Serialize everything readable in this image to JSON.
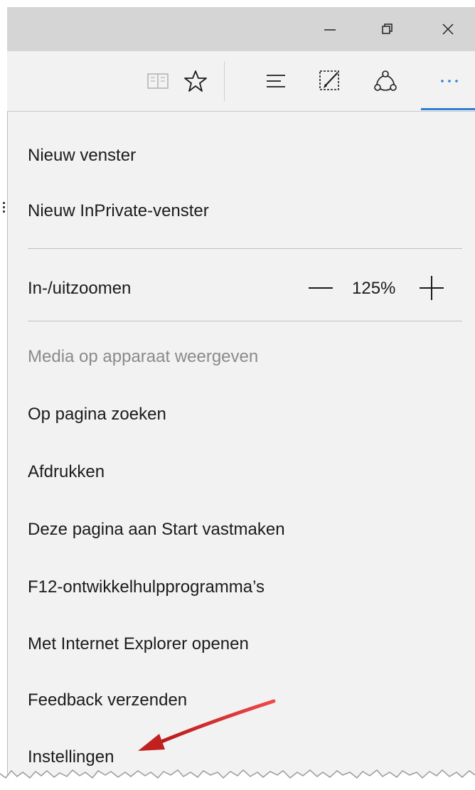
{
  "titlebar": {
    "minimize_icon": "minimize-icon",
    "restore_icon": "restore-icon",
    "close_icon": "close-icon"
  },
  "toolbar": {
    "icons": [
      "reading-view-icon",
      "favorite-star-icon",
      "hub-icon",
      "web-note-icon",
      "share-icon",
      "more-icon"
    ],
    "accent": "#2f7fd6"
  },
  "menu": {
    "new_window": "Nieuw venster",
    "new_inprivate": "Nieuw InPrivate-venster",
    "zoom": {
      "label": "In-/uitzoomen",
      "value": "125%"
    },
    "cast_media": "Media op apparaat weergeven",
    "find_on_page": "Op pagina zoeken",
    "print": "Afdrukken",
    "pin_to_start": "Deze pagina aan Start vastmaken",
    "dev_tools": "F12-ontwikkelhulpprogramma’s",
    "open_ie": "Met Internet Explorer openen",
    "send_feedback": "Feedback verzenden",
    "settings": "Instellingen"
  },
  "annotation": {
    "arrow_color": "#d42a2a"
  }
}
